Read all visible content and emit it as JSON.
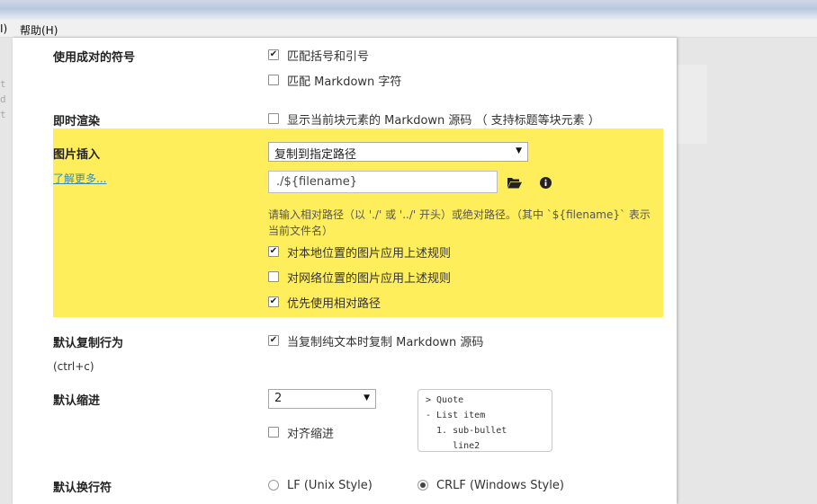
{
  "menu": {
    "left_fragment": "I)",
    "help": "帮助(H)"
  },
  "ghost_lines": [
    "t",
    "d",
    "t"
  ],
  "sections": {
    "pairs": {
      "label": "使用成对的符号",
      "options": [
        {
          "text": "匹配括号和引号",
          "checked": true
        },
        {
          "text": "匹配 Markdown 字符",
          "checked": false
        }
      ]
    },
    "live_render": {
      "label": "即时渲染",
      "option": {
        "text": "显示当前块元素的 Markdown 源码 （ 支持标题等块元素 ）",
        "checked": false
      }
    },
    "image_insert": {
      "label": "图片插入",
      "learn_more": "了解更多...",
      "select_value": "复制到指定路径",
      "path_value": "./${filename}",
      "hint_line1": "请输入相对路径（以 './' 或 '../' 开头）或绝对路径。（其中 `${filename}` 表示",
      "hint_line2": "当前文件名）",
      "options": [
        {
          "text": "对本地位置的图片应用上述规则",
          "checked": true
        },
        {
          "text": "对网络位置的图片应用上述规则",
          "checked": false
        },
        {
          "text": "优先使用相对路径",
          "checked": true
        }
      ],
      "icons": [
        "folder-open-icon",
        "info-icon"
      ]
    },
    "copy": {
      "label": "默认复制行为",
      "sublabel": "(ctrl+c)",
      "option": {
        "text": "当复制纯文本时复制 Markdown 源码",
        "checked": true
      }
    },
    "indent": {
      "label": "默认缩进",
      "select_value": "2",
      "option": {
        "text": "对齐缩进",
        "checked": false
      },
      "preview_text": "> Quote\n- List item\n  1. sub-bullet\n     line2"
    },
    "linebreak": {
      "label": "默认换行符",
      "options": [
        {
          "text": "LF (Unix Style)",
          "selected": false
        },
        {
          "text": "CRLF (Windows Style)",
          "selected": true
        }
      ]
    }
  },
  "colors": {
    "highlight": "#ffee5c",
    "link": "#3a8ab8",
    "panel": "#ffffff",
    "background": "#e6e6e6"
  }
}
